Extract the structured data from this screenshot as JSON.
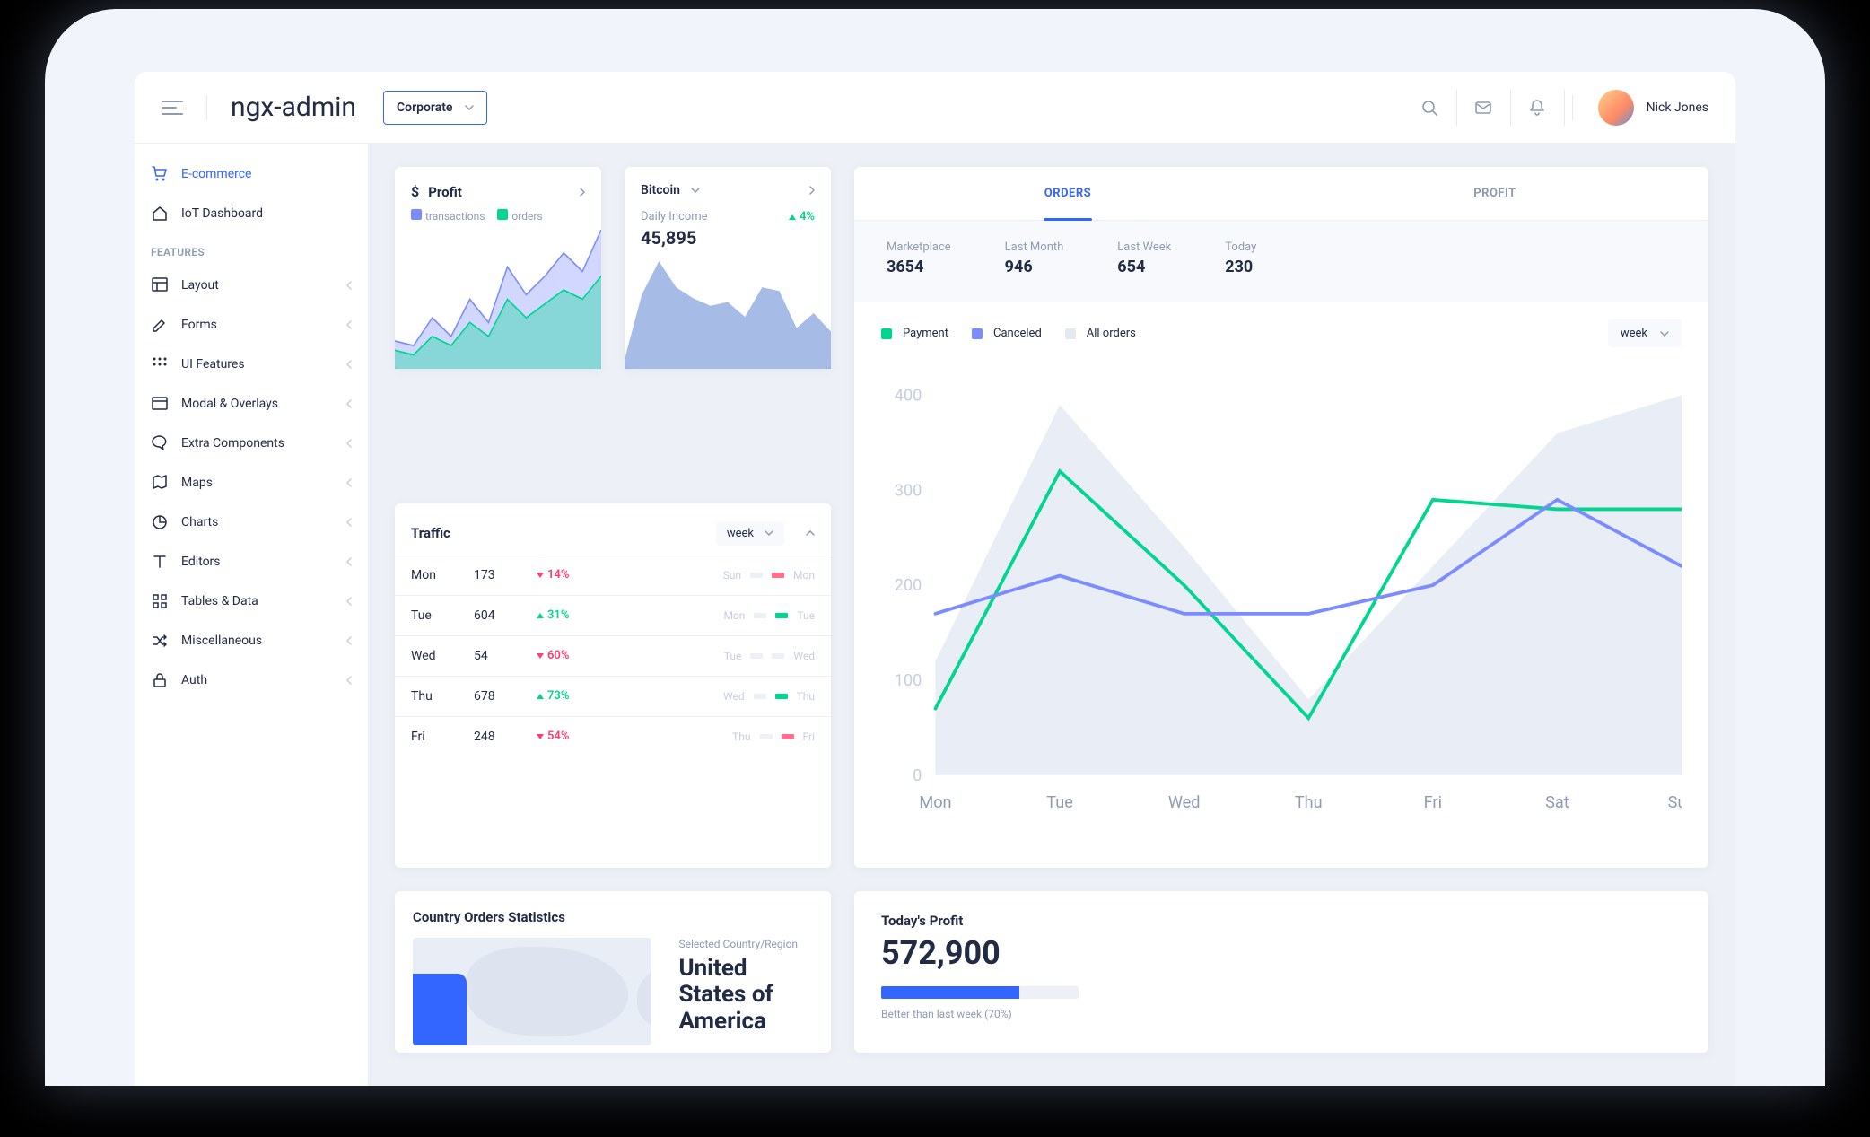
{
  "header": {
    "app_title": "ngx-admin",
    "theme_label": "Corporate",
    "user_name": "Nick Jones"
  },
  "sidebar": {
    "items_top": [
      {
        "icon": "cart-icon",
        "label": "E-commerce",
        "active": true
      },
      {
        "icon": "home-icon",
        "label": "IoT Dashboard",
        "active": false
      }
    ],
    "heading": "FEATURES",
    "items": [
      {
        "icon": "layout-icon",
        "label": "Layout"
      },
      {
        "icon": "edit-icon",
        "label": "Forms"
      },
      {
        "icon": "grid-icon",
        "label": "UI Features"
      },
      {
        "icon": "browser-icon",
        "label": "Modal & Overlays"
      },
      {
        "icon": "message-icon",
        "label": "Extra Components"
      },
      {
        "icon": "map-icon",
        "label": "Maps"
      },
      {
        "icon": "piechart-icon",
        "label": "Charts"
      },
      {
        "icon": "text-icon",
        "label": "Editors"
      },
      {
        "icon": "grid4-icon",
        "label": "Tables & Data"
      },
      {
        "icon": "shuffle-icon",
        "label": "Miscellaneous"
      },
      {
        "icon": "lock-icon",
        "label": "Auth"
      }
    ]
  },
  "profit": {
    "title": "Profit",
    "legend": [
      {
        "label": "transactions",
        "color": "#7a8cff"
      },
      {
        "label": "orders",
        "color": "#00d68f"
      }
    ]
  },
  "bitcoin": {
    "select_label": "Bitcoin",
    "income_label": "Daily Income",
    "income_value": "45,895",
    "delta": "4%",
    "delta_dir": "up"
  },
  "traffic": {
    "title": "Traffic",
    "period": "week",
    "rows": [
      {
        "day": "Mon",
        "value": "173",
        "delta": "14%",
        "dir": "down",
        "prev": "Sun",
        "curr": "Mon",
        "color": "#ff708d"
      },
      {
        "day": "Tue",
        "value": "604",
        "delta": "31%",
        "dir": "up",
        "prev": "Mon",
        "curr": "Tue",
        "color": "#00d68f"
      },
      {
        "day": "Wed",
        "value": "54",
        "delta": "60%",
        "dir": "down",
        "prev": "Tue",
        "curr": "Wed",
        "color": "#edf1f7"
      },
      {
        "day": "Thu",
        "value": "678",
        "delta": "73%",
        "dir": "up",
        "prev": "Wed",
        "curr": "Thu",
        "color": "#00d68f"
      },
      {
        "day": "Fri",
        "value": "248",
        "delta": "54%",
        "dir": "down",
        "prev": "Thu",
        "curr": "Fri",
        "color": "#ff708d"
      }
    ]
  },
  "orders": {
    "tabs": [
      {
        "label": "ORDERS",
        "active": true
      },
      {
        "label": "PROFIT",
        "active": false
      }
    ],
    "summary": [
      {
        "label": "Marketplace",
        "value": "3654"
      },
      {
        "label": "Last Month",
        "value": "946"
      },
      {
        "label": "Last Week",
        "value": "654"
      },
      {
        "label": "Today",
        "value": "230"
      }
    ],
    "legend": [
      {
        "label": "Payment",
        "color": "#00d68f"
      },
      {
        "label": "Canceled",
        "color": "#7a8cff"
      },
      {
        "label": "All orders",
        "color": "#e4e9f2"
      }
    ],
    "period": "week"
  },
  "country": {
    "title": "Country Orders Statistics",
    "sub": "Selected Country/Region",
    "name": "United States of America"
  },
  "today_profit": {
    "title": "Today's Profit",
    "value": "572,900",
    "progress": 70,
    "note": "Better than last week (70%)"
  },
  "chart_data": [
    {
      "id": "profit-mini",
      "type": "area",
      "series": [
        {
          "name": "transactions",
          "color": "#7a8cff",
          "values": [
            12,
            10,
            22,
            14,
            30,
            20,
            44,
            32,
            40,
            50,
            42,
            60
          ]
        },
        {
          "name": "orders",
          "color": "#00d68f",
          "values": [
            8,
            6,
            14,
            10,
            20,
            14,
            30,
            22,
            28,
            34,
            30,
            40
          ]
        }
      ]
    },
    {
      "id": "bitcoin-mini",
      "type": "area",
      "series": [
        {
          "name": "btc",
          "color": "#6b8dd6",
          "values": [
            5,
            40,
            58,
            44,
            38,
            34,
            36,
            28,
            44,
            42,
            22,
            30,
            20
          ]
        }
      ]
    },
    {
      "id": "orders-main",
      "type": "line",
      "categories": [
        "Mon",
        "Tue",
        "Wed",
        "Thu",
        "Fri",
        "Sat",
        "Sun"
      ],
      "ylim": [
        0,
        400
      ],
      "yticks": [
        0,
        100,
        200,
        300,
        400
      ],
      "series": [
        {
          "name": "All orders",
          "color": "#e4e9f2",
          "type": "area",
          "values": [
            120,
            390,
            240,
            80,
            220,
            360,
            400
          ]
        },
        {
          "name": "Payment",
          "color": "#00d68f",
          "values": [
            70,
            320,
            200,
            60,
            290,
            280,
            280
          ]
        },
        {
          "name": "Canceled",
          "color": "#7a8cff",
          "values": [
            170,
            210,
            170,
            170,
            200,
            290,
            220
          ]
        }
      ]
    }
  ]
}
